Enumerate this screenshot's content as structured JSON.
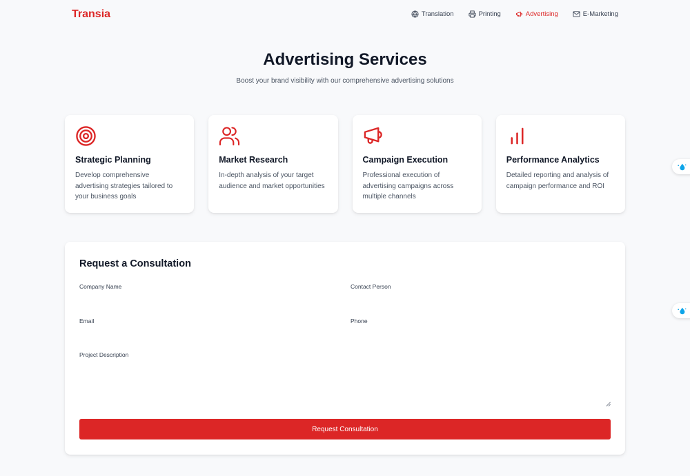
{
  "nav": {
    "brand": "Transia",
    "links": [
      {
        "label": "Translation",
        "icon": "globe-icon"
      },
      {
        "label": "Printing",
        "icon": "printer-icon"
      },
      {
        "label": "Advertising",
        "icon": "megaphone-icon",
        "active": true
      },
      {
        "label": "E-Marketing",
        "icon": "mail-icon"
      }
    ]
  },
  "hero": {
    "title": "Advertising Services",
    "subtitle": "Boost your brand visibility with our comprehensive advertising solutions"
  },
  "cards": [
    {
      "icon": "target-icon",
      "title": "Strategic Planning",
      "description": "Develop comprehensive advertising strategies tailored to your business goals"
    },
    {
      "icon": "users-icon",
      "title": "Market Research",
      "description": "In-depth analysis of your target audience and market opportunities"
    },
    {
      "icon": "megaphone-icon",
      "title": "Campaign Execution",
      "description": "Professional execution of advertising campaigns across multiple channels"
    },
    {
      "icon": "bar-chart-icon",
      "title": "Performance Analytics",
      "description": "Detailed reporting and analysis of campaign performance and ROI"
    }
  ],
  "form": {
    "title": "Request a Consultation",
    "fields": {
      "company_name": {
        "label": "Company Name",
        "value": ""
      },
      "contact_person": {
        "label": "Contact Person",
        "value": ""
      },
      "email": {
        "label": "Email",
        "value": ""
      },
      "phone": {
        "label": "Phone",
        "value": ""
      },
      "project_description": {
        "label": "Project Description",
        "value": ""
      }
    },
    "submit_label": "Request Consultation"
  },
  "colors": {
    "accent": "#dc2626",
    "background": "#f8f9fb",
    "card": "#ffffff",
    "heading": "#111827",
    "body_text": "#4b5563"
  }
}
